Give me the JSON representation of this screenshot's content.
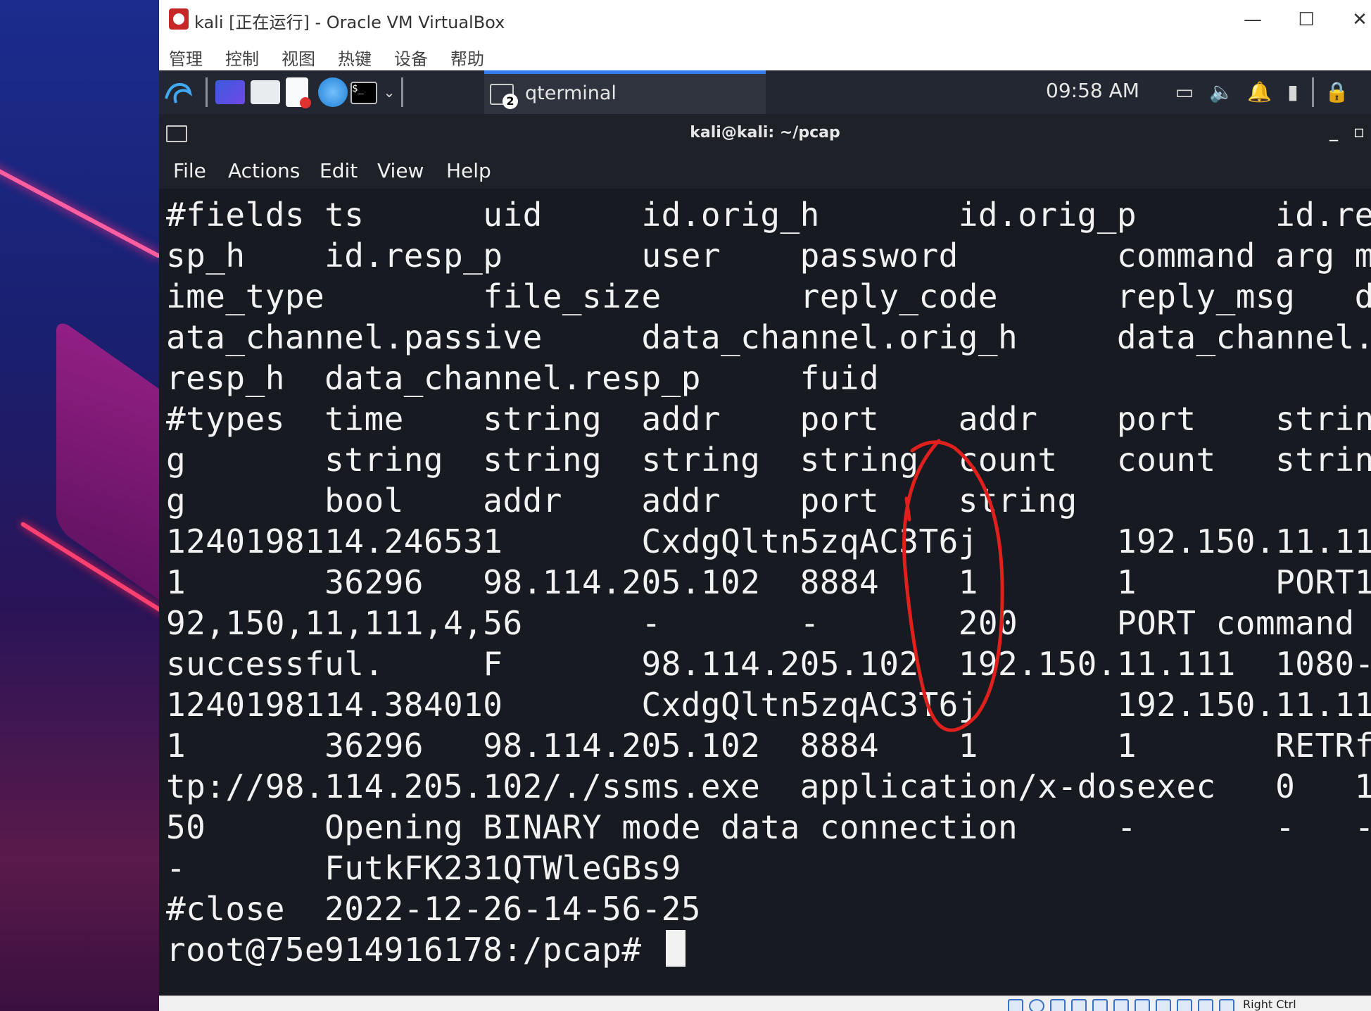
{
  "vbox": {
    "title": "kali [正在运行] - Oracle VM VirtualBox",
    "menu": [
      "管理",
      "控制",
      "视图",
      "热键",
      "设备",
      "帮助"
    ],
    "status_text": "Right Ctrl"
  },
  "panel": {
    "task_label": "qterminal",
    "task_badge": "2",
    "clock": "09:58 AM"
  },
  "terminal": {
    "title": "kali@kali: ~/pcap",
    "menu": [
      "File",
      "Actions",
      "Edit",
      "View",
      "Help"
    ],
    "lines": [
      "#fields ts      uid     id.orig_h       id.orig_p       id.re",
      "sp_h    id.resp_p       user    password        command arg m",
      "ime_type        file_size       reply_code      reply_msg   d",
      "ata_channel.passive     data_channel.orig_h     data_channel.",
      "resp_h  data_channel.resp_p     fuid",
      "#types  time    string  addr    port    addr    port    strin",
      "g       string  string  string  string  count   count   strin",
      "g       bool    addr    addr    port    string",
      "1240198114.246531       CxdgQltn5zqAC3T6j       192.150.11.11",
      "1       36296   98.114.205.102  8884    1       1       PORT1",
      "92,150,11,111,4,56      -       -       200     PORT command ",
      "successful.     F       98.114.205.102  192.150.11.111  1080-",
      "1240198114.384010       CxdgQltn5zqAC3T6j       192.150.11.11",
      "1       36296   98.114.205.102  8884    1       1       RETRf",
      "tp://98.114.205.102/./ssms.exe  application/x-dosexec   0   1",
      "50      Opening BINARY mode data connection     -       -   -",
      "-       FutkFK231QTWleGBs9",
      "#close  2022-12-26-14-56-25",
      "root@75e914916178:/pcap# "
    ]
  },
  "colors": {
    "annotation": "#e0201c",
    "panel_accent": "#367bf0",
    "terminal_bg": "#171a21"
  },
  "icons": [
    "kali-logo-icon",
    "workspace-icon",
    "folder-icon",
    "text-editor-icon",
    "browser-icon",
    "terminal-icon",
    "chevron-down-icon",
    "display-icon",
    "volume-icon",
    "bell-icon",
    "battery-icon",
    "lock-icon"
  ]
}
